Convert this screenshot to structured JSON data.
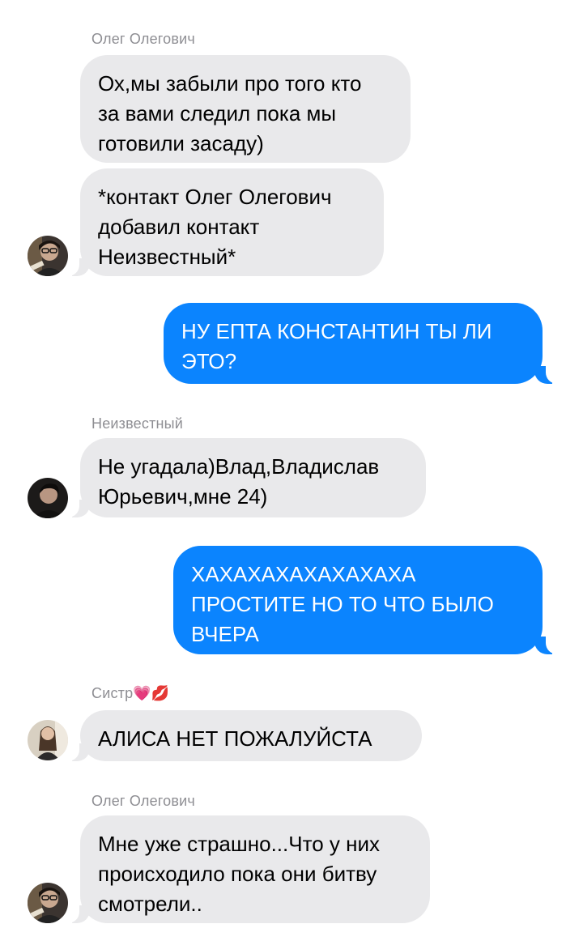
{
  "messages": [
    {
      "sender": "Олег Олегович",
      "text": "Ох,мы забыли про того кто\nза вами следил пока мы\nготовили засаду)"
    },
    {
      "text": "*контакт Олег Олегович\nдобавил контакт\nНеизвестный*"
    },
    {
      "text": "НУ ЕПТА КОНСТАНТИН ТЫ ЛИ\nЭТО?"
    },
    {
      "sender": "Неизвестный",
      "text": "Не угадала)Влад,Владислав\nЮрьевич,мне 24)"
    },
    {
      "text": "ХАХАХАХАХАХАХАХА\nПРОСТИТЕ НО ТО ЧТО БЫЛО\nВЧЕРА"
    },
    {
      "sender": "Систр",
      "sender_emoji": "💗💋",
      "text": "АЛИСА НЕТ ПОЖАЛУЙСТА"
    },
    {
      "sender": "Олег Олегович",
      "text": "Мне уже страшно...Что у них\nпроисходило пока они битву\nсмотрели.."
    }
  ],
  "colors": {
    "incoming_bubble": "#e9e9eb",
    "outgoing_bubble": "#0b84fe",
    "sender_label": "#8e8e93"
  },
  "icons": {
    "avatar_oleg": "avatar-oleg-icon",
    "avatar_unknown": "avatar-unknown-icon",
    "avatar_sistr": "avatar-sistr-icon"
  }
}
